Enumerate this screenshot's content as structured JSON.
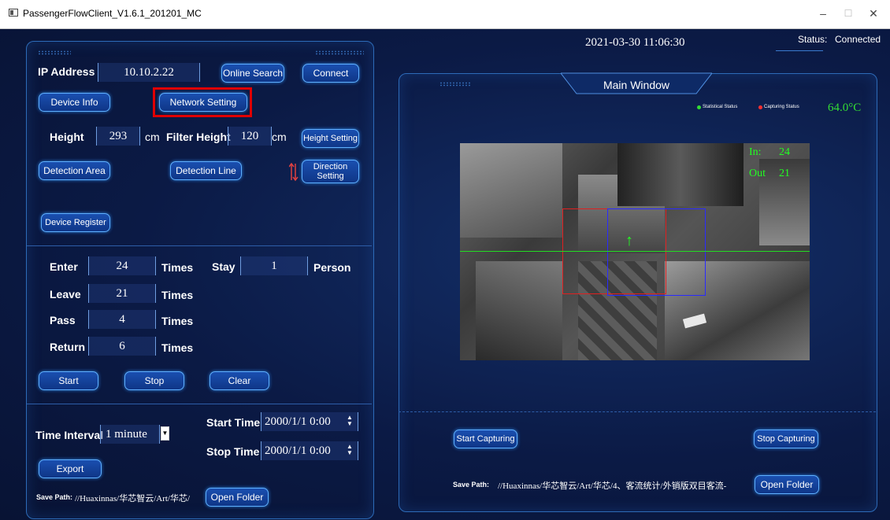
{
  "window": {
    "title": "PassengerFlowClient_V1.6.1_201201_MC"
  },
  "header": {
    "datetime": "2021-03-30 11:06:30",
    "status_label": "Status:",
    "status_value": "Connected"
  },
  "device": {
    "ip_label": "IP Address",
    "ip_value": "10.10.2.22",
    "online_search": "Online Search",
    "connect": "Connect",
    "device_info": "Device Info",
    "network_setting": "Network Setting",
    "height_label": "Height",
    "height_value": "293",
    "height_unit": "cm",
    "filter_height_label": "Filter Height",
    "filter_height_value": "120",
    "filter_height_unit": "cm",
    "height_setting": "Height Setting",
    "detection_area": "Detection Area",
    "detection_line": "Detection Line",
    "direction_setting_1": "Direction",
    "direction_setting_2": "Setting",
    "device_register": "Device Register"
  },
  "counts": {
    "enter_label": "Enter",
    "enter_value": "24",
    "enter_unit": "Times",
    "stay_label": "Stay",
    "stay_value": "1",
    "stay_unit": "Person",
    "leave_label": "Leave",
    "leave_value": "21",
    "leave_unit": "Times",
    "pass_label": "Pass",
    "pass_value": "4",
    "pass_unit": "Times",
    "return_label": "Return",
    "return_value": "6",
    "return_unit": "Times",
    "start": "Start",
    "stop": "Stop",
    "clear": "Clear"
  },
  "export_panel": {
    "time_interval_label": "Time Interval",
    "time_interval_value": "1  minute",
    "start_time_label": "Start Time",
    "start_time_value": "2000/1/1 0:00",
    "stop_time_label": "Stop Time",
    "stop_time_value": "2000/1/1 0:00",
    "export": "Export",
    "save_path_label": "Save Path:",
    "save_path_value": "//Huaxinnas/华芯智云/Art/华芯/",
    "open_folder": "Open Folder"
  },
  "main_window": {
    "title": "Main Window",
    "legend_statistical": "Statistical Status",
    "legend_capturing": "Capturing Status",
    "temperature": "64.0°C",
    "overlay_in_label": "In:",
    "overlay_in_value": "24",
    "overlay_out_label": "Out",
    "overlay_out_value": "21",
    "start_capturing": "Start Capturing",
    "stop_capturing": "Stop Capturing",
    "save_path_label": "Save Path:",
    "save_path_value": "//Huaxinnas/华芯智云/Art/华芯/4、客流统计/外销版双目客流-",
    "open_folder": "Open Folder"
  },
  "colors": {
    "accent": "#2d6bb8",
    "button": "#1a4fb0",
    "highlight": "#e00000",
    "legend_green": "#33dd33",
    "legend_red": "#ff3030",
    "temperature": "#33dd33"
  }
}
